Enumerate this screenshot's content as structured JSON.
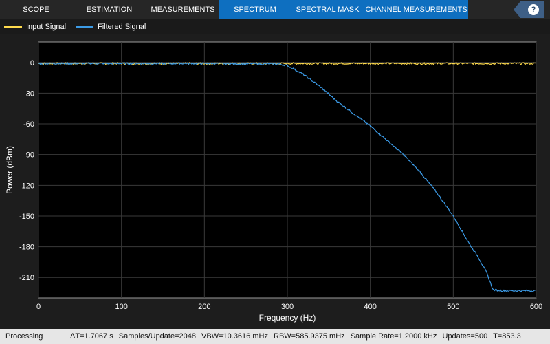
{
  "tabs": [
    {
      "label": "SCOPE"
    },
    {
      "label": "ESTIMATION"
    },
    {
      "label": "MEASUREMENTS"
    },
    {
      "label": "SPECTRUM"
    },
    {
      "label": "SPECTRAL MASK"
    },
    {
      "label": "CHANNEL MEASUREMENTS"
    }
  ],
  "help_label": "?",
  "colors": {
    "input": "#ffdb4d",
    "filtered": "#3c9be6",
    "tab_highlight": "#0e6fc0",
    "plot_bg": "#000000"
  },
  "status": {
    "left": "Processing",
    "items": [
      "ΔT=1.7067 s",
      "Samples/Update=2048",
      "VBW=10.3616 mHz",
      "RBW=585.9375 mHz",
      "Sample Rate=1.2000 kHz",
      "Updates=500",
      "T=853.3"
    ]
  },
  "chart_data": {
    "type": "line",
    "xlabel": "Frequency (Hz)",
    "ylabel": "Power (dBm)",
    "xlim": [
      0,
      600
    ],
    "ylim": [
      -230,
      20
    ],
    "xticks": [
      0,
      100,
      200,
      300,
      400,
      500,
      600
    ],
    "yticks": [
      0,
      -30,
      -60,
      -90,
      -120,
      -150,
      -180,
      -210
    ],
    "grid": true,
    "legend_position": "top-left",
    "series": [
      {
        "name": "Input Signal",
        "color": "#ffdb4d",
        "x": [
          0,
          100,
          200,
          300,
          400,
          500,
          600
        ],
        "y": [
          -1,
          -1,
          -1,
          -1,
          -1,
          -1,
          -1
        ]
      },
      {
        "name": "Filtered Signal",
        "color": "#3c9be6",
        "x": [
          0,
          100,
          200,
          290,
          300,
          320,
          340,
          360,
          380,
          400,
          420,
          440,
          460,
          480,
          500,
          520,
          530,
          540,
          548,
          560,
          580,
          600
        ],
        "y": [
          -1,
          -1,
          -1,
          -1.5,
          -3,
          -12,
          -24,
          -38,
          -50,
          -62,
          -76,
          -90,
          -107,
          -127,
          -150,
          -178,
          -190,
          -205,
          -222,
          -223,
          -223,
          -223
        ]
      }
    ]
  }
}
